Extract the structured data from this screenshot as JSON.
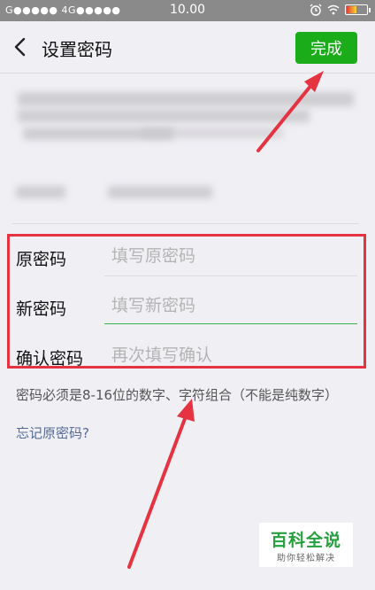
{
  "status_bar": {
    "carrier": "G●●●●● 4G●●●●●",
    "time": "10.00"
  },
  "header": {
    "title": "设置密码",
    "done_label": "完成"
  },
  "form": {
    "rows": [
      {
        "label": "原密码",
        "placeholder": "填写原密码"
      },
      {
        "label": "新密码",
        "placeholder": "填写新密码"
      },
      {
        "label": "确认密码",
        "placeholder": "再次填写确认"
      }
    ]
  },
  "hint": "密码必须是8-16位的数字、字符组合（不能是纯数字）",
  "forgot_link": "忘记原密码?",
  "watermark": {
    "main": "百科全说",
    "sub": "助你轻松解决"
  },
  "colors": {
    "accent_green": "#1aad19",
    "highlight_red": "#e53341",
    "link_blue": "#576b95"
  }
}
